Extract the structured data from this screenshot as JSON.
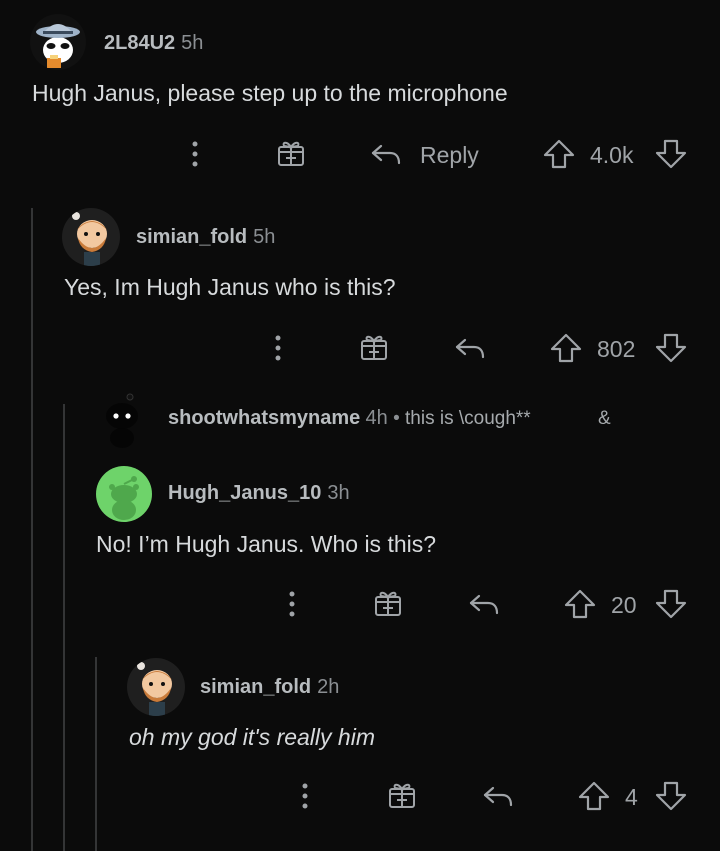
{
  "comments": [
    {
      "username": "2L84U2",
      "time": "5h",
      "text": "Hugh Janus, please step up to the microphone",
      "reply_label": "Reply",
      "score": "4.0k"
    },
    {
      "username": "simian_fold",
      "time": "5h",
      "text": "Yes, Im Hugh Janus who is this?",
      "score": "802"
    },
    {
      "username": "shootwhatsmyname",
      "time": "4h",
      "separator": "•",
      "text": "this is \\cough**",
      "trailing": "&"
    },
    {
      "username": "Hugh_Janus_10",
      "time": "3h",
      "text": "No! I’m Hugh Janus. Who is this?",
      "score": "20"
    },
    {
      "username": "simian_fold",
      "time": "2h",
      "text": "oh my god it's really him",
      "score": "4"
    }
  ],
  "icons": {
    "more": "more-vertical-icon",
    "award": "gift-award-icon",
    "reply": "reply-arrow-icon",
    "upvote": "upvote-arrow-icon",
    "downvote": "downvote-arrow-icon"
  },
  "colors": {
    "background": "#0b0b0b",
    "text": "#d7dadc",
    "muted": "#8b8f93",
    "thread_line": "#343536",
    "green_avatar": "#6ed36a"
  }
}
